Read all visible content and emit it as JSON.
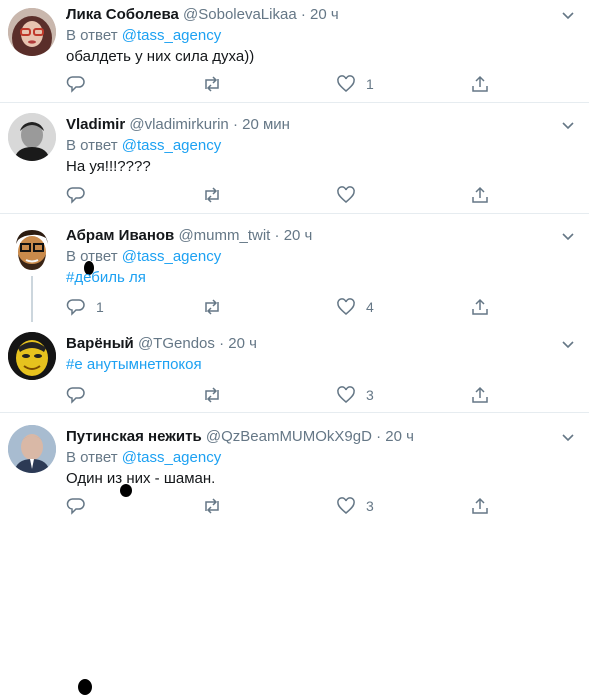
{
  "tweets": [
    {
      "name": "Лика Соболева",
      "handle": "@SobolevaLikaa",
      "dot": "·",
      "time": "20 ч",
      "reply_prefix": "В ответ",
      "reply_to": "@tass_agency",
      "text": "обалдеть у них сила духа))",
      "reply_count": "",
      "retweet_count": "",
      "like_count": "1"
    },
    {
      "name": "Vladimir",
      "handle": "@vladimirkurin",
      "dot": "·",
      "time": "20 мин",
      "reply_prefix": "В ответ",
      "reply_to": "@tass_agency",
      "text": "На уя!!!????",
      "reply_count": "",
      "retweet_count": "",
      "like_count": ""
    },
    {
      "name": "Абрам Иванов",
      "handle": "@mumm_twit",
      "dot": "·",
      "time": "20 ч",
      "reply_prefix": "В ответ",
      "reply_to": "@tass_agency",
      "text": "#дебиль  ля",
      "reply_count": "1",
      "retweet_count": "",
      "like_count": "4"
    },
    {
      "name": "Варёный",
      "handle": "@TGendos",
      "dot": "·",
      "time": "20 ч",
      "text": "#е  анутымнетпокоя",
      "reply_count": "",
      "retweet_count": "",
      "like_count": "3"
    },
    {
      "name": "Путинская нежить",
      "handle": "@QzBeamMUMOkX9gD",
      "dot": "·",
      "time": "20 ч",
      "reply_prefix": "В ответ",
      "reply_to": "@tass_agency",
      "text": "Один из них - шаман.",
      "reply_count": "",
      "retweet_count": "",
      "like_count": "3"
    }
  ],
  "icons": {
    "reply": "reply-icon",
    "retweet": "retweet-icon",
    "like": "heart-icon",
    "share": "share-icon",
    "more": "chevron-down-icon"
  },
  "colors": {
    "name": "#14171a",
    "secondary": "#657786",
    "link": "#1da1f2",
    "divider": "#e6ecf0"
  }
}
